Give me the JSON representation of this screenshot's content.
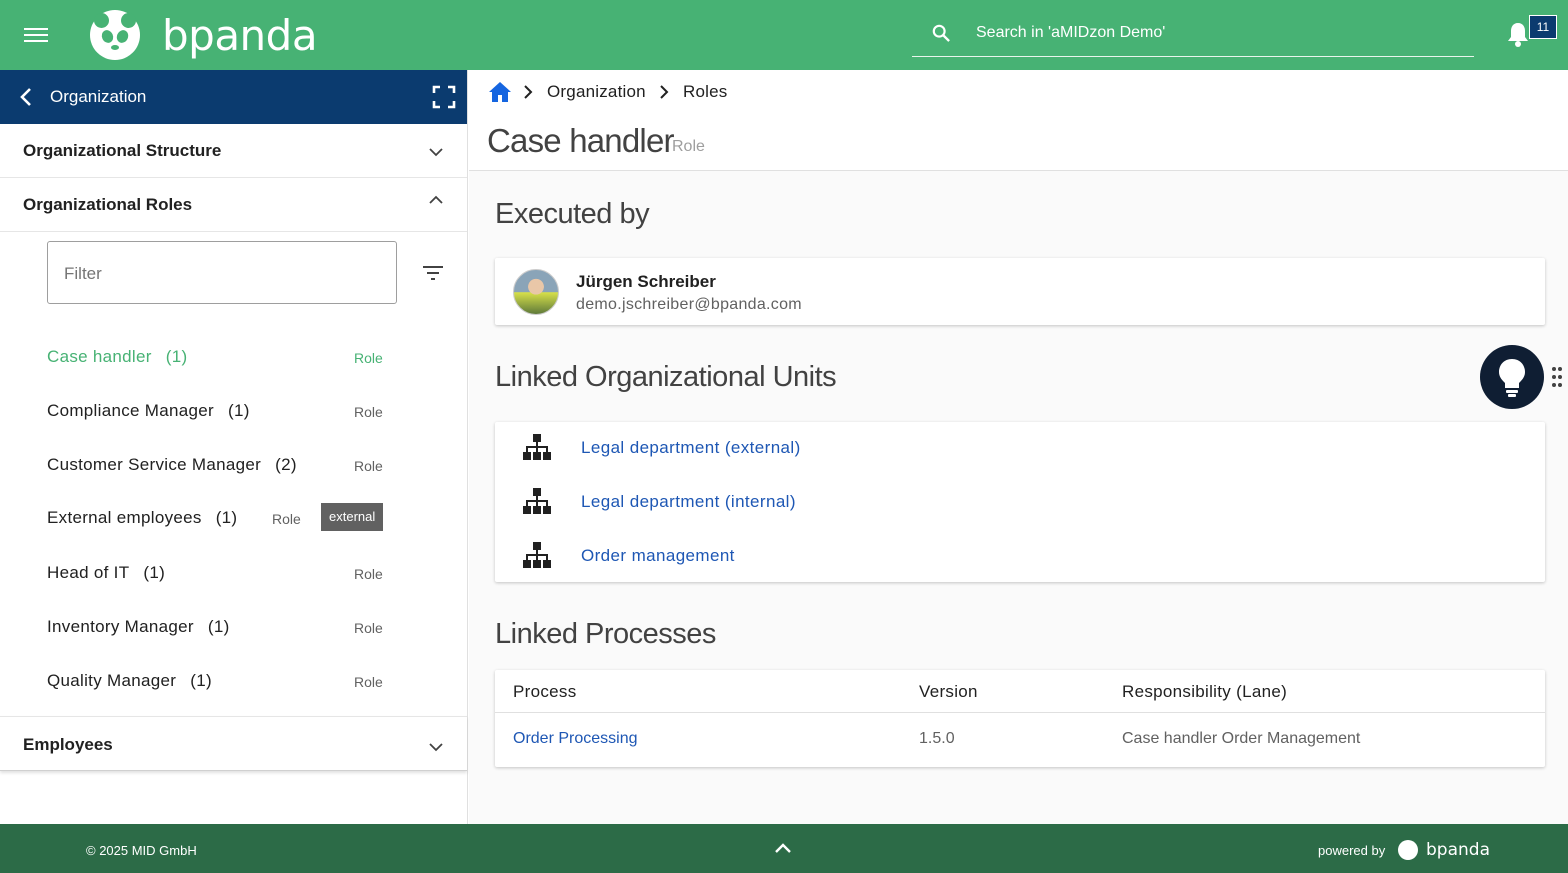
{
  "app": {
    "logo_text": "bpanda",
    "search_placeholder": "Search in 'aMIDzon Demo'",
    "notification_count": "11",
    "brand_color": "#47b274",
    "nav_color": "#0b3b6f",
    "footer_color": "#2c6b47"
  },
  "sidebar": {
    "title": "Organization",
    "sections": {
      "structure": "Organizational Structure",
      "roles": "Organizational Roles",
      "employees": "Employees"
    },
    "filter_placeholder": "Filter",
    "roles": [
      {
        "name": "Case handler",
        "count": "(1)",
        "type": "Role"
      },
      {
        "name": "Compliance Manager",
        "count": "(1)",
        "type": "Role"
      },
      {
        "name": "Customer Service Manager",
        "count": "(2)",
        "type": "Role"
      },
      {
        "name": "External employees",
        "count": "(1)",
        "type": "Role",
        "tag": "external"
      },
      {
        "name": "Head of IT",
        "count": "(1)",
        "type": "Role"
      },
      {
        "name": "Inventory Manager",
        "count": "(1)",
        "type": "Role"
      },
      {
        "name": "Quality Manager",
        "count": "(1)",
        "type": "Role"
      }
    ]
  },
  "breadcrumb": {
    "items": [
      "Organization",
      "Roles"
    ]
  },
  "page": {
    "title": "Case handler",
    "subtitle": "Role"
  },
  "executed_by": {
    "heading": "Executed by",
    "person": {
      "name": "Jürgen Schreiber",
      "email": "demo.jschreiber@bpanda.com"
    }
  },
  "linked_units": {
    "heading": "Linked Organizational Units",
    "items": [
      "Legal department (external)",
      "Legal department (internal)",
      "Order management"
    ]
  },
  "linked_processes": {
    "heading": "Linked Processes",
    "columns": [
      "Process",
      "Version",
      "Responsibility (Lane)"
    ],
    "rows": [
      {
        "process": "Order Processing",
        "version": "1.5.0",
        "lane": "Case handler Order Management"
      }
    ]
  },
  "footer": {
    "copyright": "© 2025 MID GmbH",
    "powered_by": "powered by",
    "logo_text": "bpanda"
  }
}
